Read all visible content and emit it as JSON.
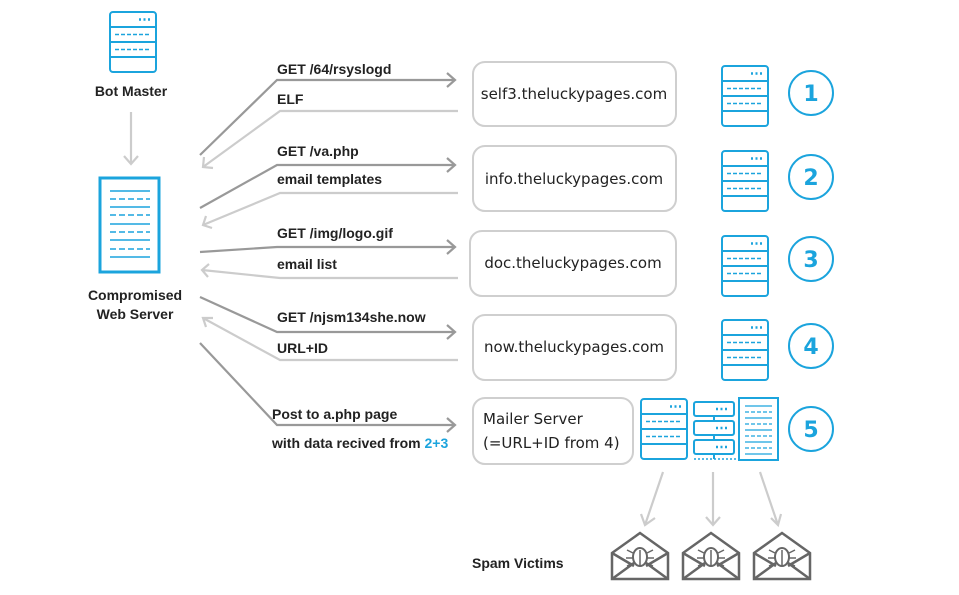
{
  "nodes": {
    "bot_master": "Bot Master",
    "compromised_line1": "Compromised",
    "compromised_line2": "Web Server",
    "spam_victims": "Spam Victims"
  },
  "steps": [
    {
      "number": "1",
      "host": "self3.theluckypages.com",
      "request": "GET /64/rsyslogd",
      "response": "ELF"
    },
    {
      "number": "2",
      "host": "info.theluckypages.com",
      "request": "GET /va.php",
      "response": "email templates"
    },
    {
      "number": "3",
      "host": "doc.theluckypages.com",
      "request": "GET /img/logo.gif",
      "response": "email list"
    },
    {
      "number": "4",
      "host": "now.theluckypages.com",
      "request": "GET /njsm134she.now",
      "response": "URL+ID"
    },
    {
      "number": "5",
      "host_line1": "Mailer Server",
      "host_line2": "(=URL+ID from 4)",
      "request_line1": "Post to a.php page",
      "request_line2": "with data recived from ",
      "request_highlight": "2+3"
    }
  ],
  "colors": {
    "accent": "#1ba4dd",
    "request_arrow": "#999999",
    "response_arrow": "#cccccc",
    "icon_gray": "#666666"
  }
}
